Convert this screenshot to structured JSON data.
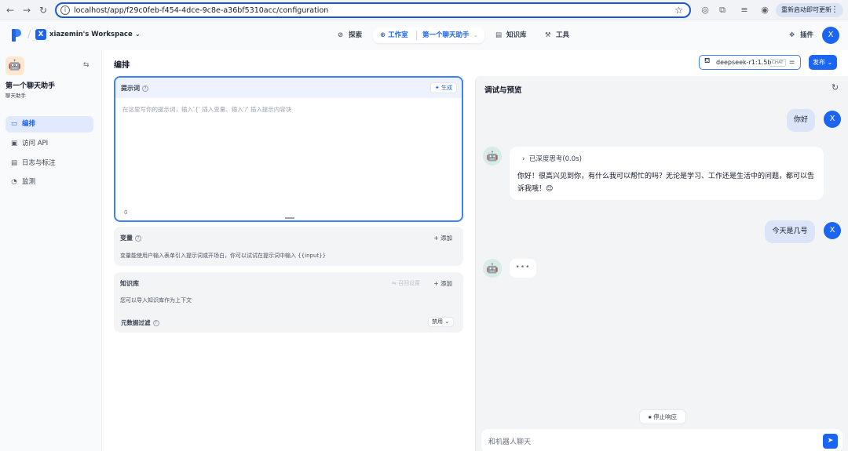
{
  "browser": {
    "url": "localhost/app/f29c0feb-f454-4dce-9c8e-a36bf5310acc/configuration",
    "update_button": "重新启动即可更新"
  },
  "header": {
    "workspace_avatar": "X",
    "workspace_name": "xiazemin's Workspace",
    "nav": {
      "explore": "探索",
      "studio": "工作室",
      "current_app": "第一个聊天助手",
      "knowledge": "知识库",
      "tools": "工具",
      "plugins": "插件"
    },
    "user_avatar": "X"
  },
  "sidebar": {
    "app_name": "第一个聊天助手",
    "app_type": "聊天助手",
    "items": [
      {
        "label": "编排",
        "icon": "orchestrate-icon",
        "active": true
      },
      {
        "label": "访问 API",
        "icon": "terminal-icon",
        "active": false
      },
      {
        "label": "日志与标注",
        "icon": "log-icon",
        "active": false
      },
      {
        "label": "监测",
        "icon": "monitor-icon",
        "active": false
      }
    ]
  },
  "orchestrate": {
    "title": "编排",
    "prompt": {
      "label": "提示词",
      "generate": "生成",
      "placeholder": "在这里写你的提示词，输入'{' 插入变量、输入'/' 插入提示内容块",
      "count": "0"
    },
    "variables": {
      "label": "变量",
      "add": "添加",
      "description": "变量能使用户输入表单引入提示词或开场白，你可以试试在提示词中输入 {{input}}"
    },
    "knowledge": {
      "label": "知识库",
      "recall_settings": "召回设置",
      "add": "添加",
      "description": "您可以导入知识库作为上下文"
    },
    "metadata_filter": {
      "label": "元数据过滤",
      "value": "禁用"
    }
  },
  "toolbar": {
    "model_name": "deepseek-r1:1.5b",
    "model_tag": "CHAT",
    "publish": "发布"
  },
  "debug": {
    "title": "调试与预览",
    "messages": [
      {
        "role": "user",
        "text": "你好"
      },
      {
        "role": "bot",
        "thinking": "已深度思考(0.0s)",
        "text": "你好！很高兴见到你，有什么我可以帮忙的吗？无论是学习、工作还是生活中的问题，都可以告诉我哦！😊"
      },
      {
        "role": "user",
        "text": "今天是几号"
      },
      {
        "role": "bot",
        "typing": "•••"
      }
    ],
    "stop_button": "停止响应",
    "input_placeholder": "和机器人聊天"
  },
  "colors": {
    "accent": "#1c64f2",
    "user_bubble": "#dbe4f9",
    "panel_bg": "#f3f4f6"
  }
}
